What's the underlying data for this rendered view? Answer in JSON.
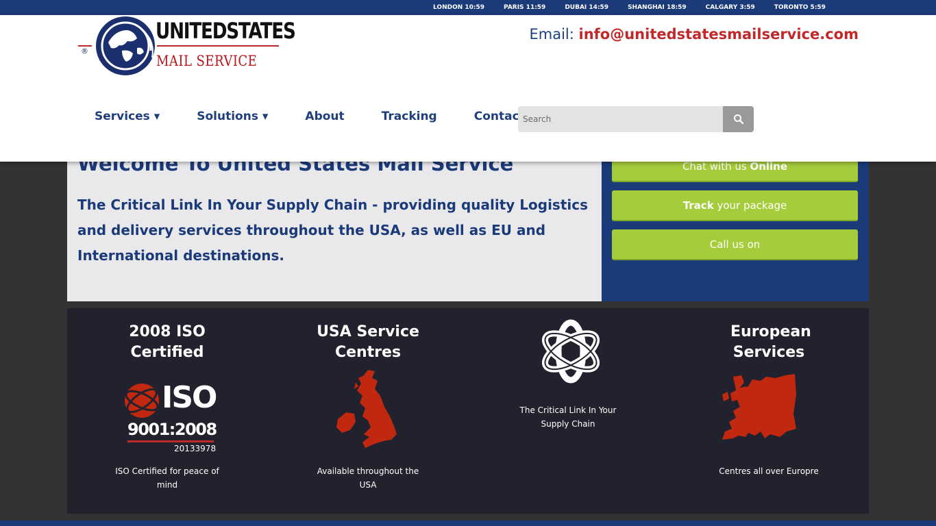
{
  "clocks": [
    "LONDON 10:59",
    "PARIS 11:59",
    "DUBAI 14:59",
    "SHANGHAI 18:59",
    "CALGARY 3:59",
    "TORONTO 5:59"
  ],
  "logo": {
    "registered": "®",
    "line1": "UNITEDSTATES",
    "line2": "MAIL SERVICE"
  },
  "email": {
    "label": "Email: ",
    "value": "info@unitedstatesmailservice.com"
  },
  "nav": [
    {
      "label": "Services ▾"
    },
    {
      "label": "Solutions ▾"
    },
    {
      "label": "About"
    },
    {
      "label": "Tracking"
    },
    {
      "label": "Contact"
    }
  ],
  "search": {
    "placeholder": "Search"
  },
  "welcome": {
    "title": "Welcome To United States Mail Service",
    "text": "The Critical Link In Your Supply Chain - providing quality Logistics and delivery services throughout the USA, as well as EU and International destinations."
  },
  "side_buttons": {
    "chat_pre": "Chat with us ",
    "chat_bold": "Online",
    "track_bold": "Track",
    "track_post": " your package",
    "call": "Call us on"
  },
  "features": [
    {
      "title": "2008 ISO Certified",
      "text": "ISO Certified for peace of mind",
      "iso_word": "ISO",
      "iso_number": "9001:2008",
      "iso_cert": "20133978"
    },
    {
      "title": "USA Service Centres",
      "text": "Available throughout the USA"
    },
    {
      "title": "",
      "text": "The Critical Link In Your Supply Chain"
    },
    {
      "title": "European Services",
      "text": "Centres all over Europre"
    }
  ],
  "colors": {
    "navy": "#1b3a7a",
    "red": "#c0282a",
    "green": "#a5cc3a",
    "dark": "#22222e",
    "map_red": "#c0280f"
  }
}
